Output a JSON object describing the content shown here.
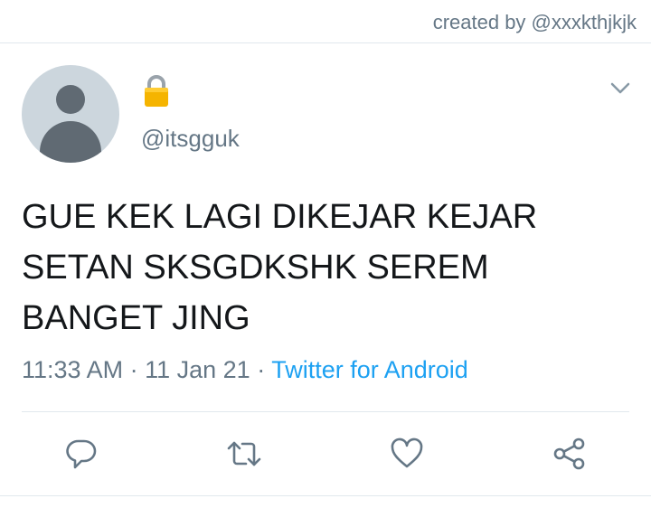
{
  "header": {
    "credit": "created by @xxxkthjkjk"
  },
  "tweet": {
    "handle": "@itsgguk",
    "text": "GUE KEK LAGI DIKEJAR KEJAR\nSETAN SKSGDKSHK SEREM\nBANGET JING",
    "time": "11:33 AM",
    "separator1": " · ",
    "date": "11 Jan 21",
    "separator2": " · ",
    "source": "Twitter for Android"
  },
  "icons": {
    "lock": "lock-icon",
    "menu": "chevron-down-icon",
    "reply": "reply-icon",
    "retweet": "retweet-icon",
    "like": "heart-icon",
    "share": "share-icon"
  },
  "colors": {
    "secondary_text": "#657786",
    "link": "#1da1f2",
    "divider": "#e1e8ed",
    "lock_gold": "#f5b400"
  }
}
